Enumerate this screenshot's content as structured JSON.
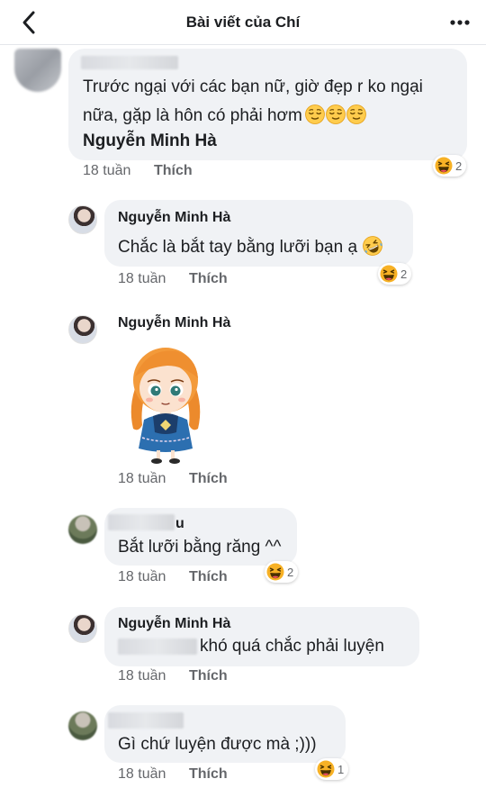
{
  "header": {
    "title": "Bài viết của Chí"
  },
  "comments": [
    {
      "text_line1": "Trước ngại với các bạn nữ, giờ đẹp r ko ngại",
      "text_line2": "nữa, gặp là hôn có phải hơm",
      "mention": "Nguyễn Minh Hà",
      "time": "18 tuần",
      "like": "Thích",
      "reaction_count": "2"
    },
    {
      "author": "Nguyễn Minh Hà",
      "text": "Chắc là bắt tay bằng lưỡi bạn ạ",
      "time": "18 tuần",
      "like": "Thích",
      "reaction_count": "2"
    },
    {
      "author": "Nguyễn Minh Hà",
      "sticker": "anna-sticker",
      "time": "18 tuần",
      "like": "Thích"
    },
    {
      "author_suffix": "u",
      "text": "Bắt lưỡi bằng răng ^^",
      "time": "18 tuần",
      "like": "Thích",
      "reaction_count": "2"
    },
    {
      "author": "Nguyễn Minh Hà",
      "text": "khó quá chắc phải luyện",
      "time": "18 tuần",
      "like": "Thích"
    },
    {
      "text": "Gì chứ luyện được mà ;)))",
      "time": "18 tuần",
      "like": "Thích",
      "reaction_count": "1"
    }
  ],
  "icons": {
    "back": "chevron-left-icon",
    "more": "more-horizontal-icon",
    "reaction": "haha-reaction-icon",
    "relieved": "relieved-face-emoji",
    "rofl": "rofl-emoji"
  },
  "colors": {
    "bubble": "#f0f2f5",
    "meta": "#65676b",
    "haha": "#f7b125"
  }
}
